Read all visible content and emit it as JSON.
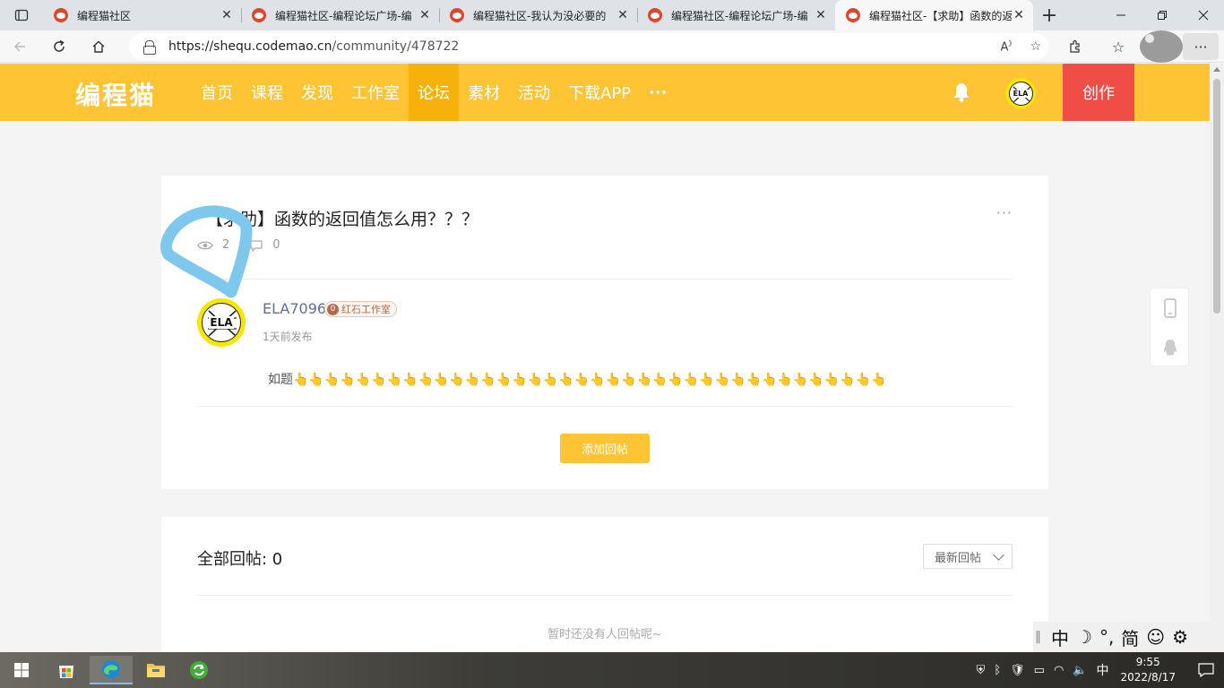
{
  "browser": {
    "tabs": [
      {
        "title": "编程猫社区"
      },
      {
        "title": "编程猫社区-编程论坛广场-编"
      },
      {
        "title": "编程猫社区-我认为没必要的"
      },
      {
        "title": "编程猫社区-编程论坛广场-编"
      },
      {
        "title": "编程猫社区-【求助】函数的返"
      }
    ],
    "url_host": "https://shequ.codemao.cn",
    "url_path": "/community/478722",
    "new_tab": "+",
    "close_glyph": "✕"
  },
  "site": {
    "logo": "编程猫",
    "nav": [
      {
        "label": "首页"
      },
      {
        "label": "课程"
      },
      {
        "label": "发现"
      },
      {
        "label": "工作室"
      },
      {
        "label": "论坛",
        "active": true
      },
      {
        "label": "素材"
      },
      {
        "label": "活动"
      },
      {
        "label": "下载APP"
      },
      {
        "label": "···"
      }
    ],
    "avatar_text": "ELA",
    "create_label": "创作",
    "accent": "#fec433",
    "create_color": "#ef4d46"
  },
  "post": {
    "title": "【求助】函数的返回值怎么用？？？",
    "more": "···",
    "views": "2",
    "comments": "0",
    "author": "ELA7096",
    "studio_level": "0",
    "studio": "红石工作室",
    "time": "1天前发布",
    "body": "如题👆👆👆👆👆👆👆👆👆👆👆👆👆👆👆👆👆👆👆👆👆👆👆👆👆👆👆👆👆👆👆👆👆👆👆👆👆👆",
    "reply_button": "添加回帖"
  },
  "replies": {
    "title": "全部回帖: 0",
    "sort": "最新回帖",
    "empty": "暂时还没有人回帖呢~"
  },
  "ime": {
    "items": [
      "中",
      "☽",
      "°,",
      "简",
      "☺",
      "⚙"
    ]
  },
  "taskbar": {
    "ime_indicator": "中",
    "time": "9:55",
    "date": "2022/8/17"
  }
}
